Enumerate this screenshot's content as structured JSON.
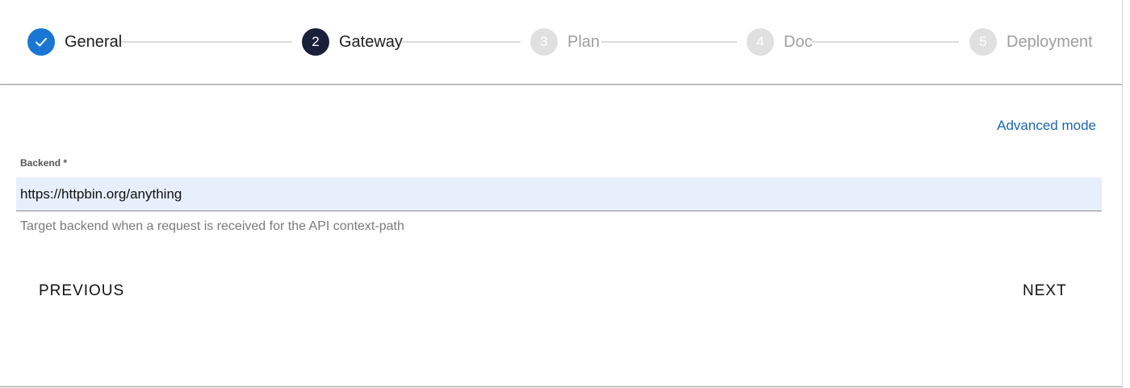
{
  "stepper": {
    "steps": [
      {
        "number": "",
        "label": "General",
        "state": "done"
      },
      {
        "number": "2",
        "label": "Gateway",
        "state": "active"
      },
      {
        "number": "3",
        "label": "Plan",
        "state": "pending"
      },
      {
        "number": "4",
        "label": "Doc",
        "state": "pending"
      },
      {
        "number": "5",
        "label": "Deployment",
        "state": "pending"
      }
    ],
    "done_icon": "check-icon"
  },
  "form": {
    "advanced_mode_label": "Advanced mode",
    "backend_label": "Backend *",
    "backend_value": "https://httpbin.org/anything",
    "backend_helper": "Target backend when a request is received for the API context-path"
  },
  "actions": {
    "previous_label": "PREVIOUS",
    "next_label": "NEXT"
  },
  "colors": {
    "done": "#1976d2",
    "active": "#1a1f3a",
    "pending": "#e0e0e0",
    "link": "#1a66b3",
    "input_bg": "#e6effb"
  }
}
